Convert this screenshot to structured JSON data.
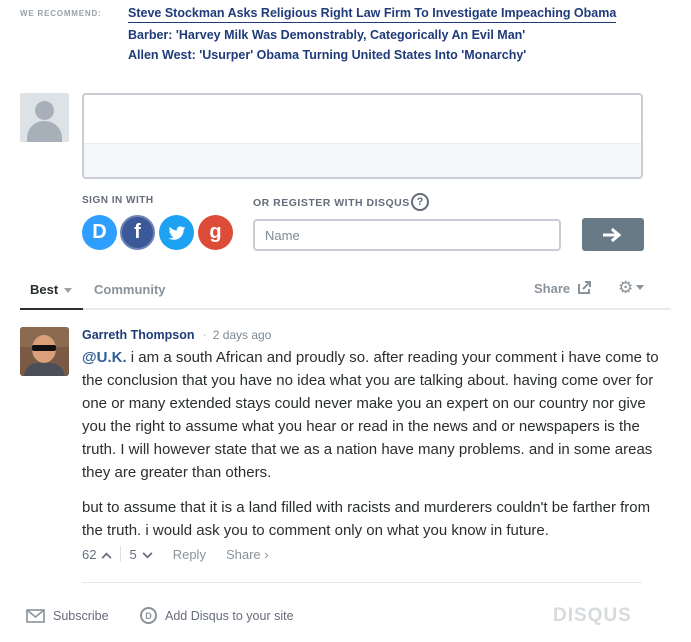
{
  "recommend": {
    "label": "WE RECOMMEND:",
    "links": [
      "Steve Stockman Asks Religious Right Law Firm To Investigate Impeaching Obama",
      "Barber: 'Harvey Milk Was Demonstrably, Categorically An Evil Man'",
      "Allen West: 'Usurper' Obama Turning United States Into 'Monarchy'"
    ]
  },
  "composer": {
    "signin_label": "SIGN IN WITH",
    "register_label": "OR REGISTER WITH DISQUS",
    "help_glyph": "?",
    "name_placeholder": "Name",
    "social": {
      "disqus": "D",
      "facebook": "f",
      "twitter": "t",
      "google": "g"
    }
  },
  "nav": {
    "best": "Best",
    "community": "Community",
    "share": "Share"
  },
  "comment": {
    "author": "Garreth Thompson",
    "separator": "·",
    "time": "2 days ago",
    "mention": "@U.K.",
    "paragraph1": " i am a south African and proudly so. after reading your comment i have come to the conclusion that you have no idea what you are talking about. having come over for one or many extended stays could never make you an expert on our country nor give you the right to assume what you hear or read in the news and or newspapers is the truth. I will however state that we as a nation have many problems. and in some areas they are greater than others.",
    "paragraph2": "but to assume that it is a land filled with racists and murderers couldn't be farther from the truth. i would ask you to comment only on what you know in future.",
    "upvotes": "62",
    "downvotes": "5",
    "reply": "Reply",
    "share": "Share ›"
  },
  "footer": {
    "subscribe": "Subscribe",
    "add_disqus": "Add Disqus to your site",
    "logo": "DISQUS"
  },
  "colors": {
    "link": "#1f3b7a",
    "disqus_blue": "#2e9fff",
    "facebook": "#3b5998",
    "twitter": "#1da1f2",
    "google": "#dd4b39",
    "submit": "#687a86"
  }
}
